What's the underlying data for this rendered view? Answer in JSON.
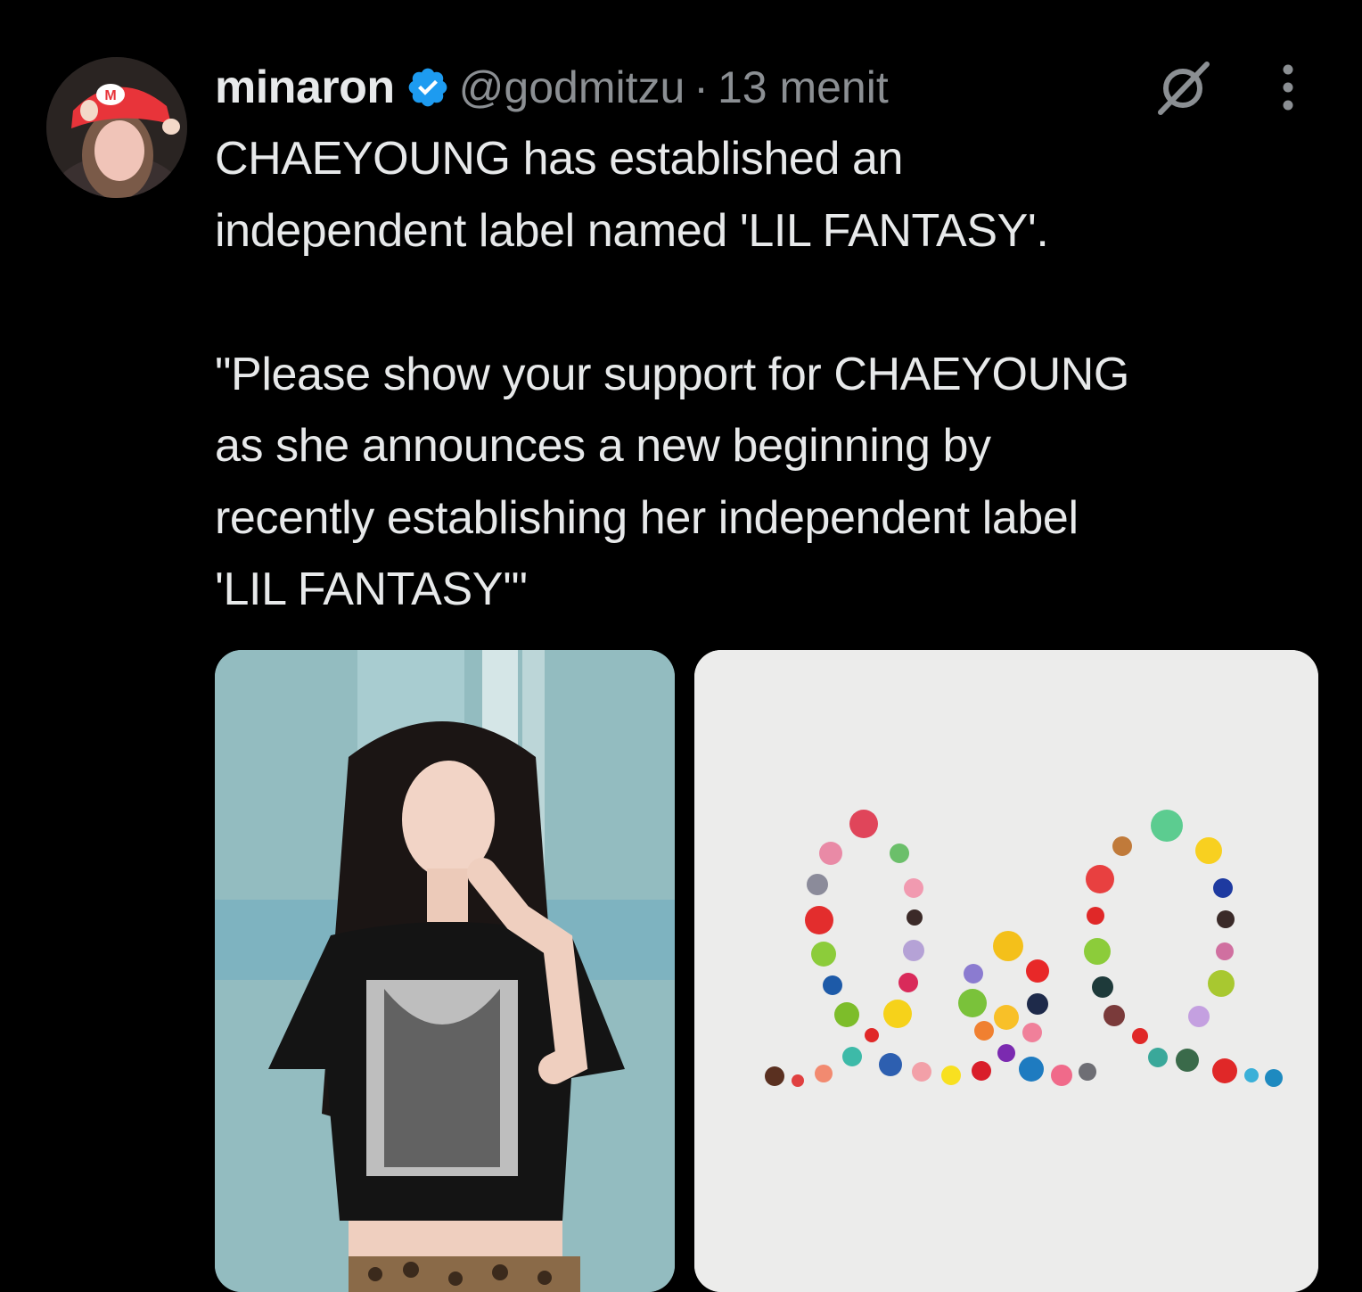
{
  "tweet": {
    "display_name": "minaron",
    "handle": "@godmitzu",
    "separator": "·",
    "timestamp": "13 menit",
    "body": "CHAEYOUNG has established an\nindependent label named 'LIL FANTASY'.\n\n\"Please show your support for CHAEYOUNG\nas she announces a new beginning by\nrecently establishing her independent label\n'LIL FANTASY'\""
  },
  "icons": {
    "verified": "verified-badge-icon",
    "grok": "grok-icon",
    "more": "more-options-icon"
  },
  "colors": {
    "background": "#000000",
    "text_primary": "#e7e9ea",
    "text_secondary": "#8b8f93",
    "verified_blue": "#1d9bf0"
  }
}
